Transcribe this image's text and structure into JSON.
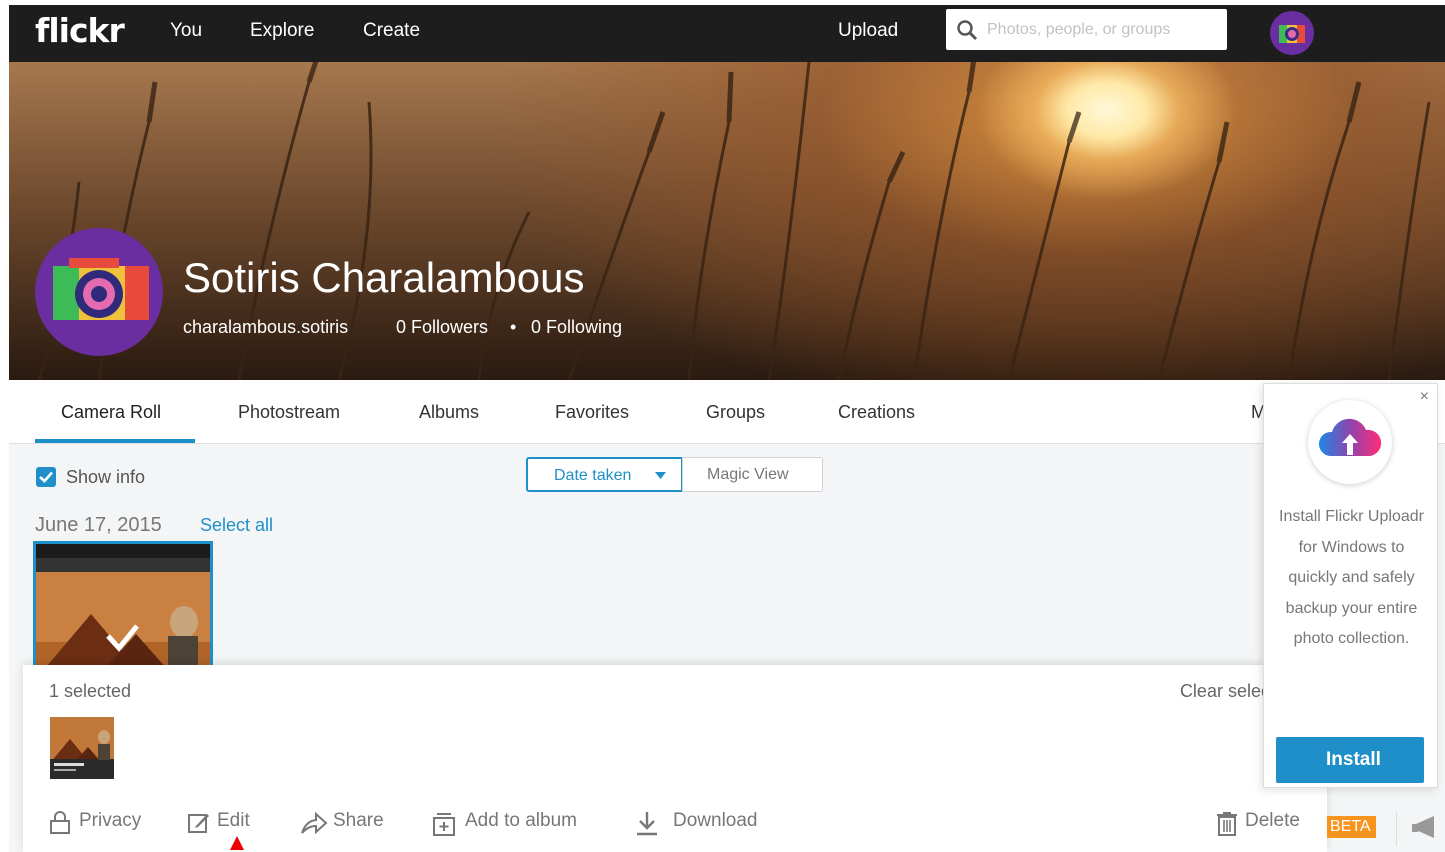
{
  "nav": {
    "logo": "flickr",
    "links": [
      "You",
      "Explore",
      "Create"
    ],
    "upload": "Upload",
    "search_placeholder": "Photos, people, or groups"
  },
  "profile": {
    "name": "Sotiris Charalambous",
    "username": "charalambous.sotiris",
    "followers": "0 Followers",
    "separator": "•",
    "following": "0 Following"
  },
  "tabs": [
    "Camera Roll",
    "Photostream",
    "Albums",
    "Favorites",
    "Groups",
    "Creations",
    "M"
  ],
  "controls": {
    "show_info": "Show info",
    "date_taken": "Date taken",
    "magic_view": "Magic View"
  },
  "roll": {
    "date": "June 17, 2015",
    "select_all": "Select all"
  },
  "selection_bar": {
    "count": "1 selected",
    "clear": "Clear selection",
    "actions": {
      "privacy": "Privacy",
      "edit": "Edit",
      "share": "Share",
      "add_to_album": "Add to album",
      "download": "Download",
      "delete": "Delete"
    }
  },
  "uploadr": {
    "close": "×",
    "message": "Install Flickr Uploadr for Windows to quickly and safely backup your entire photo collection.",
    "install": "Install",
    "beta": "BETA"
  },
  "colors": {
    "accent": "#1f8fc9",
    "nav_bg": "#1d1d1e",
    "beta": "#f7941d",
    "marker": "#e00000"
  }
}
